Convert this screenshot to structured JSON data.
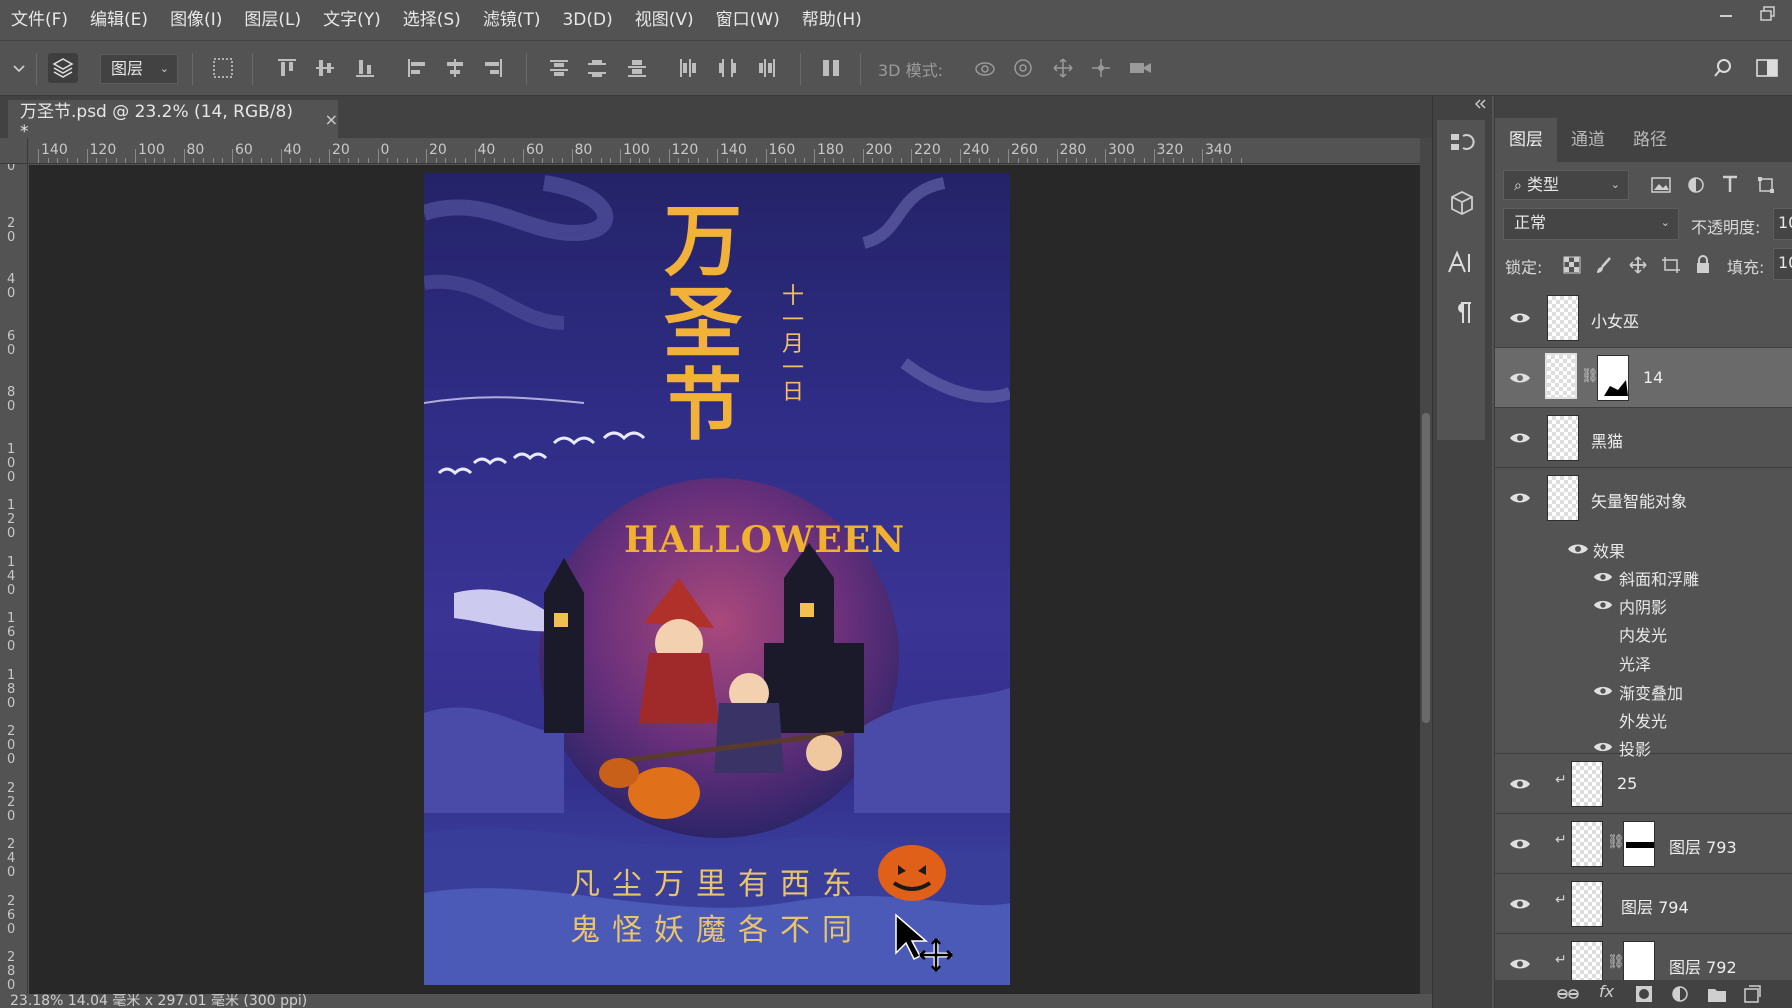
{
  "menubar": {
    "items": [
      "文件(F)",
      "编辑(E)",
      "图像(I)",
      "图层(L)",
      "文字(Y)",
      "选择(S)",
      "滤镜(T)",
      "3D(D)",
      "视图(V)",
      "窗口(W)",
      "帮助(H)"
    ]
  },
  "optionsbar": {
    "auto_select_target": "图层",
    "mode_3d_label": "3D 模式:"
  },
  "document": {
    "tab_title": "万圣节.psd @ 23.2% (14, RGB/8) *",
    "close": "×"
  },
  "ruler": {
    "top_labels": [
      "140",
      "120",
      "100",
      "80",
      "60",
      "40",
      "20",
      "0",
      "20",
      "40",
      "60",
      "80",
      "100",
      "120",
      "140",
      "160",
      "180",
      "200",
      "220",
      "240",
      "260",
      "280",
      "300",
      "320",
      "340"
    ],
    "left_labels": [
      "0",
      "2\n0",
      "4\n0",
      "6\n0",
      "8\n0",
      "1\n0\n0",
      "1\n2\n0",
      "1\n4\n0",
      "1\n6\n0",
      "1\n8\n0",
      "2\n0\n0",
      "2\n2\n0",
      "2\n4\n0",
      "2\n6\n0",
      "2\n8\n0"
    ]
  },
  "poster": {
    "title_chars": [
      "万",
      "圣",
      "节"
    ],
    "date_chars": [
      "十",
      "一",
      "月",
      "一",
      "日"
    ],
    "halloween_text": "HALLOWEEN",
    "line1": "凡尘万里有西东",
    "line2": "鬼怪妖魔各不同"
  },
  "statusbar": {
    "text": "23.18%   14.04 毫米 x 297.01 毫米 (300 ppi)"
  },
  "panel": {
    "tabs": [
      "图层",
      "通道",
      "路径"
    ],
    "active_tab": "图层",
    "filter_kind": "类型",
    "blend_mode": "正常",
    "opacity_label": "不透明度:",
    "opacity_value": "10",
    "lock_label": "锁定:",
    "fill_label": "填充:",
    "fill_value": "10",
    "layers": [
      {
        "name": "小女巫"
      },
      {
        "name": "14"
      },
      {
        "name": "黑猫"
      },
      {
        "name": "矢量智能对象"
      },
      {
        "name": "25"
      },
      {
        "name": "图层 793"
      },
      {
        "name": "图层 794"
      },
      {
        "name": "图层 792"
      }
    ],
    "effects_label": "效果",
    "effects": [
      "斜面和浮雕",
      "内阴影",
      "内发光",
      "光泽",
      "渐变叠加",
      "外发光",
      "投影"
    ]
  },
  "colors": {
    "chrome": "#535353",
    "chrome_dark": "#424242",
    "canvas_bg": "#282828",
    "poster_title": "#f2b23a",
    "poster_text": "#e8c46a",
    "selected_layer": "#6a6a6a"
  }
}
